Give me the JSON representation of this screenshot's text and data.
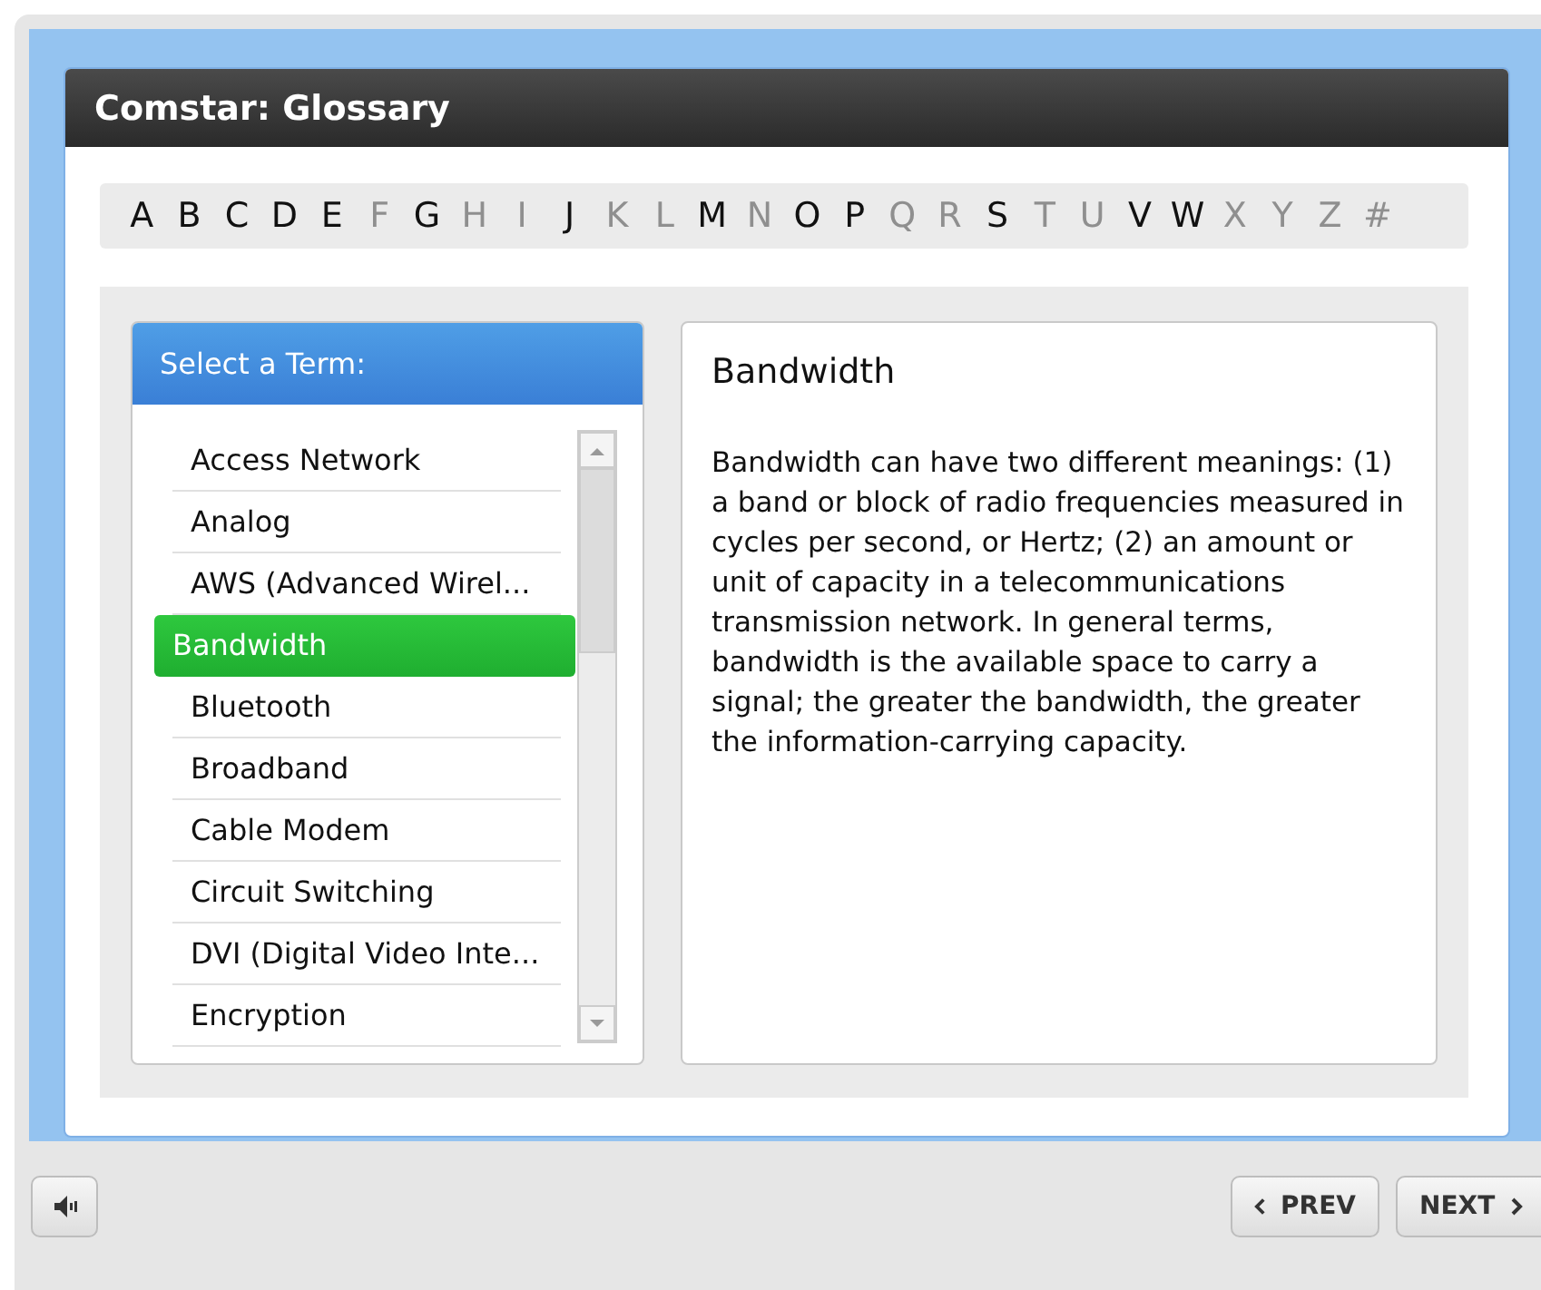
{
  "window": {
    "title": "Comstar: Glossary"
  },
  "letters": [
    {
      "label": "A",
      "disabled": false
    },
    {
      "label": "B",
      "disabled": false
    },
    {
      "label": "C",
      "disabled": false
    },
    {
      "label": "D",
      "disabled": false
    },
    {
      "label": "E",
      "disabled": false
    },
    {
      "label": "F",
      "disabled": true
    },
    {
      "label": "G",
      "disabled": false
    },
    {
      "label": "H",
      "disabled": true
    },
    {
      "label": "I",
      "disabled": true
    },
    {
      "label": "J",
      "disabled": false
    },
    {
      "label": "K",
      "disabled": true
    },
    {
      "label": "L",
      "disabled": true
    },
    {
      "label": "M",
      "disabled": false
    },
    {
      "label": "N",
      "disabled": true
    },
    {
      "label": "O",
      "disabled": false
    },
    {
      "label": "P",
      "disabled": false
    },
    {
      "label": "Q",
      "disabled": true
    },
    {
      "label": "R",
      "disabled": true
    },
    {
      "label": "S",
      "disabled": false
    },
    {
      "label": "T",
      "disabled": true
    },
    {
      "label": "U",
      "disabled": true
    },
    {
      "label": "V",
      "disabled": false
    },
    {
      "label": "W",
      "disabled": false
    },
    {
      "label": "X",
      "disabled": true
    },
    {
      "label": "Y",
      "disabled": true
    },
    {
      "label": "Z",
      "disabled": true
    },
    {
      "label": "#",
      "disabled": true
    }
  ],
  "terms": {
    "heading": "Select a Term:",
    "items": [
      {
        "label": "Access Network",
        "selected": false
      },
      {
        "label": "Analog",
        "selected": false
      },
      {
        "label": "AWS (Advanced Wirel...",
        "selected": false
      },
      {
        "label": "Bandwidth",
        "selected": true
      },
      {
        "label": "Bluetooth",
        "selected": false
      },
      {
        "label": "Broadband",
        "selected": false
      },
      {
        "label": "Cable Modem",
        "selected": false
      },
      {
        "label": "Circuit Switching",
        "selected": false
      },
      {
        "label": "DVI (Digital Video Inte...",
        "selected": false
      },
      {
        "label": "Encryption",
        "selected": false
      }
    ]
  },
  "definition": {
    "title": "Bandwidth",
    "text": "Bandwidth can have two different meanings: (1) a band or block of radio frequencies measured in cycles per second, or Hertz; (2) an amount or unit of capacity in a telecommunications transmission network. In general terms, bandwidth is the available space to carry a signal; the greater the bandwidth, the greater the information-carrying capacity."
  },
  "footer": {
    "prev": "PREV",
    "next": "NEXT"
  }
}
